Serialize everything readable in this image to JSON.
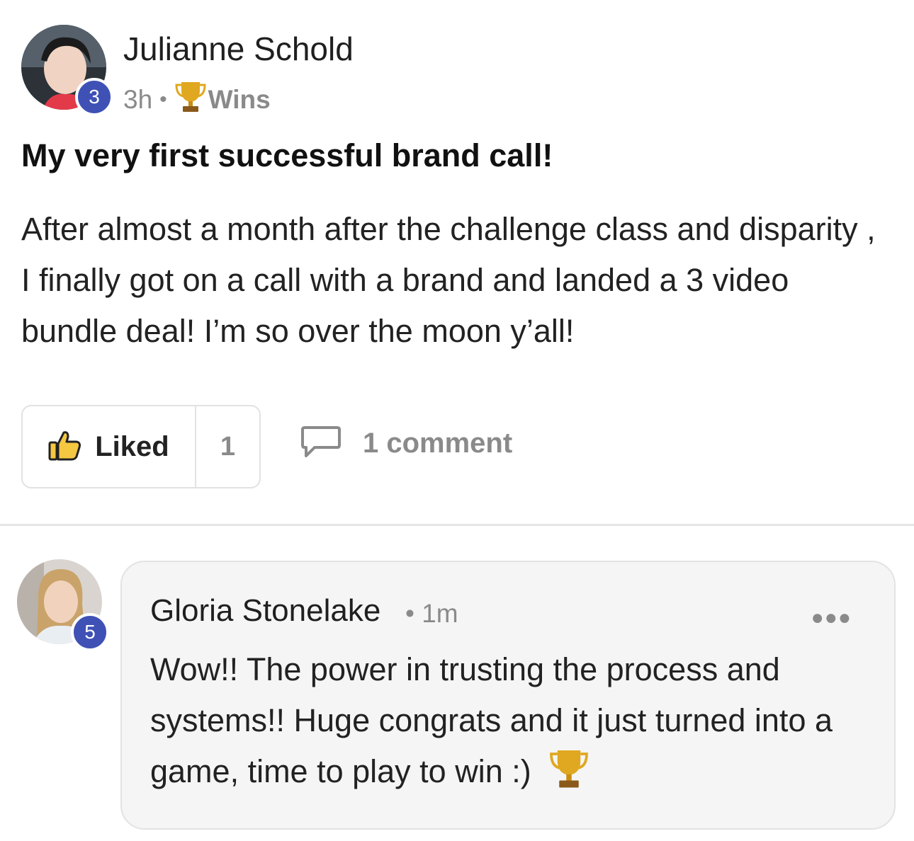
{
  "post": {
    "author": "Julianne Schold",
    "author_level": "3",
    "time": "3h",
    "separator": "•",
    "category_icon": "trophy-icon",
    "category": "Wins",
    "title": "My very first successful brand call!",
    "body": "After almost a month after the challenge class and disparity , I finally got on a call with a brand and landed a 3 video bundle deal! I’m so over the moon y’all!",
    "like_label": "Liked",
    "like_count": "1",
    "comment_label": "1 comment"
  },
  "comment": {
    "author": "Gloria Stonelake",
    "author_level": "5",
    "meta": "• 1m",
    "more_icon": "more-dots-icon",
    "body": "Wow!! The power in trusting the process and systems!! Huge congrats and it just turned into a game, time to play to win :)"
  },
  "colors": {
    "level_badge": "#3f51b5",
    "like_icon": "#f5c842",
    "muted_text": "#8a8a8a"
  }
}
